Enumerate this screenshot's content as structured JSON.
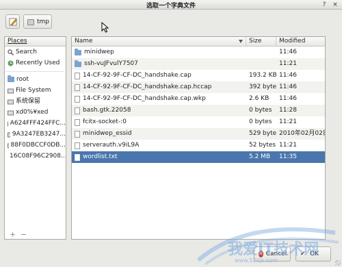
{
  "window": {
    "title": "选取一个字典文件",
    "controls": [
      "?",
      "×"
    ]
  },
  "toolbar": {
    "path_segment": "tmp"
  },
  "places": {
    "header": "Places",
    "items": [
      {
        "label": "Search",
        "icon": "search-icon"
      },
      {
        "label": "Recently Used",
        "icon": "clock-icon"
      },
      {
        "label": "root",
        "icon": "home-folder-icon"
      },
      {
        "label": "File System",
        "icon": "drive-icon"
      },
      {
        "label": "系统保留",
        "icon": "drive-icon"
      },
      {
        "label": "xd0%¥xed",
        "icon": "drive-icon"
      },
      {
        "label": "A624FFF424FFC...",
        "icon": "drive-icon"
      },
      {
        "label": "9A3247EB3247...",
        "icon": "drive-icon"
      },
      {
        "label": "88F0DBCCF0DB...",
        "icon": "drive-icon"
      },
      {
        "label": "16C08F96C2908...",
        "icon": "drive-icon"
      }
    ],
    "add_label": "+",
    "remove_label": "−"
  },
  "files": {
    "columns": {
      "name": "Name",
      "size": "Size",
      "modified": "Modified"
    },
    "rows": [
      {
        "name": "minidwep",
        "size": "",
        "modified": "11:46",
        "type": "folder"
      },
      {
        "name": "ssh-vuJFvulY7507",
        "size": "",
        "modified": "11:21",
        "type": "folder"
      },
      {
        "name": "14-CF-92-9F-CF-DC_handshake.cap",
        "size": "193.2 KB",
        "modified": "11:46",
        "type": "file"
      },
      {
        "name": "14-CF-92-9F-CF-DC_handshake.cap.hccap",
        "size": "392 bytes",
        "modified": "11:46",
        "type": "file"
      },
      {
        "name": "14-CF-92-9F-CF-DC_handshake.cap.wkp",
        "size": "2.6 KB",
        "modified": "11:46",
        "type": "file"
      },
      {
        "name": "bash.gtk.22058",
        "size": "0 bytes",
        "modified": "11:28",
        "type": "file"
      },
      {
        "name": "fcitx-socket-:0",
        "size": "0 bytes",
        "modified": "11:21",
        "type": "file"
      },
      {
        "name": "minidwep_essid",
        "size": "529 bytes",
        "modified": "2010年02月02日",
        "type": "file"
      },
      {
        "name": "serverauth.v9iL9A",
        "size": "52 bytes",
        "modified": "11:21",
        "type": "file"
      },
      {
        "name": "wordlist.txt",
        "size": "5.2 MB",
        "modified": "11:35",
        "type": "file",
        "selected": true
      }
    ]
  },
  "buttons": {
    "cancel": "Cancel",
    "ok": "OK"
  },
  "watermark": {
    "text": "我爱IT技术网",
    "url": "www.52itjs.com"
  },
  "colors": {
    "selection": "#4a76ad",
    "folder": "#7aa3d0",
    "cancel_icon": "#d03a2c"
  }
}
